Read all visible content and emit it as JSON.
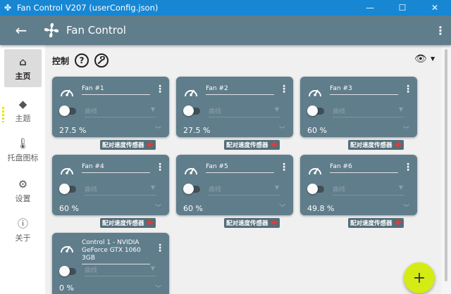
{
  "window": {
    "title": "Fan Control V207 (userConfig.json)",
    "minimize": "—",
    "maximize": "☐",
    "close": "✕"
  },
  "appbar": {
    "title": "Fan Control"
  },
  "sidebar": {
    "items": [
      {
        "label": "主页",
        "icon": "home-icon"
      },
      {
        "label": "主题",
        "icon": "paint-bucket-icon"
      },
      {
        "label": "托盘图标",
        "icon": "thermometer-icon"
      },
      {
        "label": "设置",
        "icon": "gear-icon"
      },
      {
        "label": "关于",
        "icon": "info-icon"
      }
    ]
  },
  "main": {
    "section_title": "控制",
    "help": "?",
    "cards": [
      {
        "name": "Fan #1",
        "curve": "曲线",
        "value": "27.5 %"
      },
      {
        "name": "Fan #2",
        "curve": "曲线",
        "value": "27.5 %"
      },
      {
        "name": "Fan #3",
        "curve": "曲线",
        "value": "60 %"
      },
      {
        "name": "Fan #4",
        "curve": "曲线",
        "value": "60 %"
      },
      {
        "name": "Fan #5",
        "curve": "曲线",
        "value": "60 %"
      },
      {
        "name": "Fan #6",
        "curve": "曲线",
        "value": "49.8 %"
      },
      {
        "name_line1": "Control 1 - NVIDIA",
        "name_line2": "GeForce GTX 1060 3GB",
        "curve": "曲线",
        "value": "0 %"
      }
    ],
    "pair_label": "配对速度传感器",
    "fab": "+"
  },
  "colors": {
    "titlebar": "#1787d4",
    "appbar": "#607d8b",
    "card": "#607d8b",
    "fab": "#d4ec13",
    "pair_plus": "#e53935"
  }
}
